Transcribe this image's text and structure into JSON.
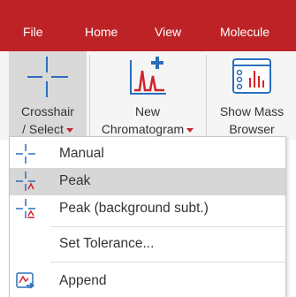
{
  "menubar": {
    "tabs": [
      "File",
      "Home",
      "View",
      "Molecule"
    ]
  },
  "ribbon": {
    "crosshair": {
      "line1": "Crosshair",
      "line2": "/ Select"
    },
    "chromatogram": {
      "line1": "New",
      "line2": "Chromatogram"
    },
    "mass": {
      "line1": "Show Mass",
      "line2": "Browser"
    }
  },
  "menu": {
    "items": [
      {
        "label": "Manual",
        "icon": "crosshair-icon",
        "selected": false
      },
      {
        "label": "Peak",
        "icon": "peak-crosshair-icon",
        "selected": true
      },
      {
        "label": "Peak (background subt.)",
        "icon": "peak-background-icon",
        "selected": false
      },
      {
        "label": "Set Tolerance...",
        "icon": "",
        "selected": false
      },
      {
        "label": "Append",
        "icon": "append-icon",
        "selected": false
      }
    ]
  },
  "colors": {
    "brand": "#bd2326",
    "icon_blue": "#2a6ebb",
    "icon_red": "#d0232a",
    "selected_bg": "#d7d7d7"
  }
}
